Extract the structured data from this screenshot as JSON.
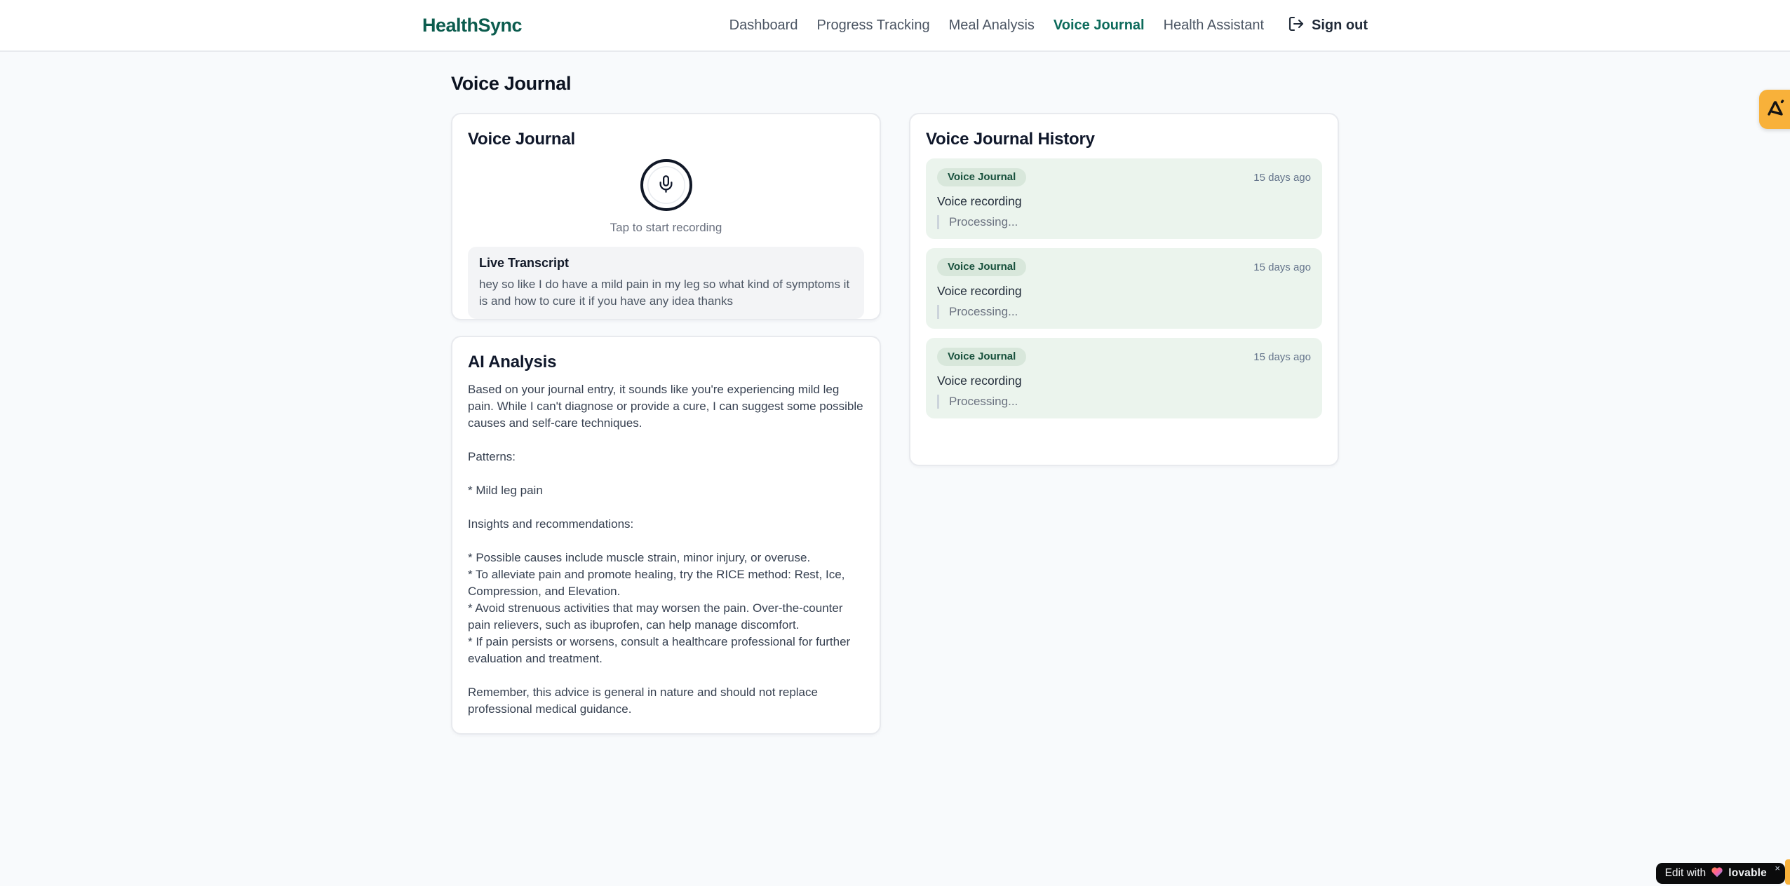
{
  "accent_colors": {
    "brand_teal": "#0c5c4e",
    "active_nav_teal": "#0d6b5c",
    "entry_green_bg": "#ebf4ed",
    "badge_green_bg": "#d8e7db",
    "badge_green_text": "#17503c",
    "extension_amber": "#f8b13a"
  },
  "header": {
    "brand": "HealthSync",
    "nav": [
      {
        "label": "Dashboard",
        "active": false
      },
      {
        "label": "Progress Tracking",
        "active": false
      },
      {
        "label": "Meal Analysis",
        "active": false
      },
      {
        "label": "Voice Journal",
        "active": true
      },
      {
        "label": "Health Assistant",
        "active": false
      }
    ],
    "signout_label": "Sign out"
  },
  "page": {
    "title": "Voice Journal"
  },
  "recorder": {
    "title": "Voice Journal",
    "tap_hint": "Tap to start recording",
    "transcript_title": "Live Transcript",
    "transcript_text": "hey so like I do have a mild pain in my leg so what kind of symptoms it is and how to cure it if you have any idea thanks"
  },
  "analysis": {
    "title": "AI Analysis",
    "body": "Based on your journal entry, it sounds like you're experiencing mild leg pain. While I can't diagnose or provide a cure, I can suggest some possible causes and self-care techniques.\n\nPatterns:\n\n* Mild leg pain\n\nInsights and recommendations:\n\n* Possible causes include muscle strain, minor injury, or overuse.\n* To alleviate pain and promote healing, try the RICE method: Rest, Ice, Compression, and Elevation.\n* Avoid strenuous activities that may worsen the pain. Over-the-counter pain relievers, such as ibuprofen, can help manage discomfort.\n* If pain persists or worsens, consult a healthcare professional for further evaluation and treatment.\n\nRemember, this advice is general in nature and should not replace professional medical guidance."
  },
  "history": {
    "title": "Voice Journal History",
    "entries": [
      {
        "badge": "Voice Journal",
        "time": "15 days ago",
        "title": "Voice recording",
        "status": "Processing..."
      },
      {
        "badge": "Voice Journal",
        "time": "15 days ago",
        "title": "Voice recording",
        "status": "Processing..."
      },
      {
        "badge": "Voice Journal",
        "time": "15 days ago",
        "title": "Voice recording",
        "status": "Processing..."
      }
    ]
  },
  "overlays": {
    "extension_icon": "lovable-extension-icon",
    "lovable_prefix": "Edit with",
    "lovable_word": "lovable",
    "lovable_close": "×"
  }
}
